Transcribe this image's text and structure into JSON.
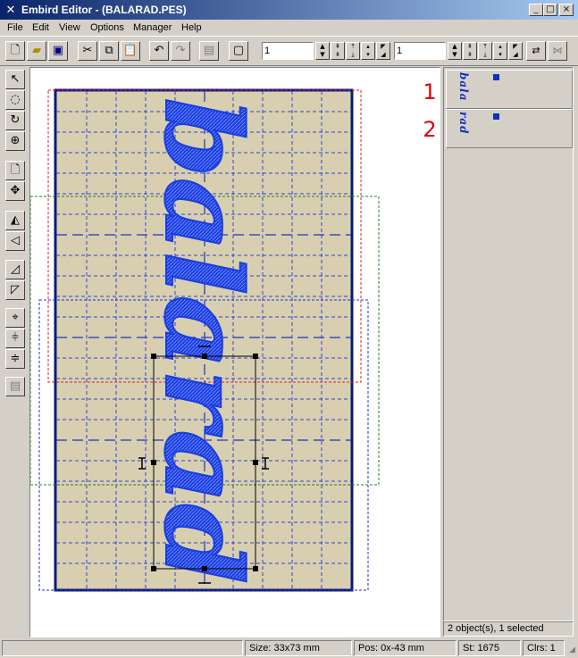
{
  "window": {
    "title": "Embird Editor - (BALARAD.PES)",
    "app_icon": "needle-icon",
    "controls": [
      "_",
      "□",
      "×"
    ]
  },
  "menu": [
    "File",
    "Edit",
    "View",
    "Options",
    "Manager",
    "Help"
  ],
  "toolbar": {
    "field1": "1",
    "field2": "1",
    "icons": [
      "new-file-icon",
      "open-folder-icon",
      "save-icon",
      "cut-icon",
      "copy-icon",
      "paste-icon",
      "undo-icon",
      "redo-icon",
      "properties-icon",
      "border-icon"
    ]
  },
  "design": {
    "text": "balarad",
    "stitch_color": "#1a3ee0",
    "fabric_color": "#d8cfb0"
  },
  "objects": {
    "items": [
      {
        "number": "1",
        "name": "bala"
      },
      {
        "number": "2",
        "name": "rad"
      }
    ],
    "status": "2 object(s), 1 selected"
  },
  "status": {
    "size": "Size: 33x73 mm",
    "pos": "Pos: 0x-43 mm",
    "stitches": "St: 1675",
    "colors": "Clrs: 1"
  }
}
